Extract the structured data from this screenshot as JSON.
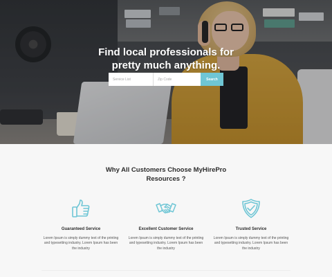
{
  "hero": {
    "title_line1": "Find local professionals for",
    "title_line2": "pretty much anything.",
    "service_placeholder": "Service List",
    "zip_placeholder": "Zip Code",
    "search_label": "Search",
    "accent_color": "#6fc6d5"
  },
  "why": {
    "title_line1": "Why All Customers Choose MyHirePro",
    "title_line2": "Resources ?",
    "features": [
      {
        "icon": "thumbs-up-icon",
        "title": "Guaranteed Service",
        "desc": "Lorem Ipsum is simply dummy text of the printing and typesetting industry. Lorem Ipsum has been the industry"
      },
      {
        "icon": "handshake-icon",
        "title": "Excellent Customer Service",
        "desc": "Lorem Ipsum is simply dummy text of the printing and typesetting industry. Lorem Ipsum has been the industry"
      },
      {
        "icon": "shield-check-icon",
        "title": "Trusted Service",
        "desc": "Lorem Ipsum is simply dummy text of the printing and typesetting industry. Lorem Ipsum has been the industry"
      }
    ],
    "icon_color": "#6fc6d5"
  }
}
